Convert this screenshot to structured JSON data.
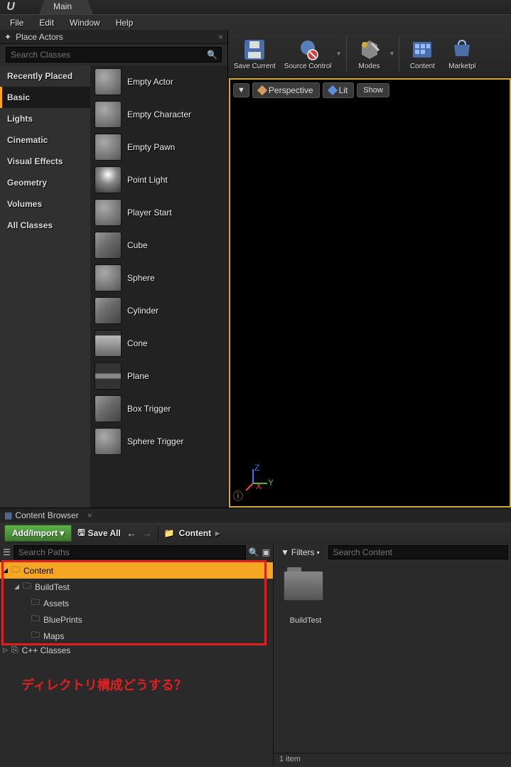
{
  "titlebar": {
    "tab": "Main"
  },
  "menu": {
    "file": "File",
    "edit": "Edit",
    "window": "Window",
    "help": "Help"
  },
  "place_actors": {
    "title": "Place Actors",
    "search_placeholder": "Search Classes",
    "categories": [
      "Recently Placed",
      "Basic",
      "Lights",
      "Cinematic",
      "Visual Effects",
      "Geometry",
      "Volumes",
      "All Classes"
    ],
    "active_category": "Basic",
    "actors": [
      "Empty Actor",
      "Empty Character",
      "Empty Pawn",
      "Point Light",
      "Player Start",
      "Cube",
      "Sphere",
      "Cylinder",
      "Cone",
      "Plane",
      "Box Trigger",
      "Sphere Trigger"
    ]
  },
  "toolbar": {
    "save": "Save Current",
    "source": "Source Control",
    "modes": "Modes",
    "content": "Content",
    "market": "Marketpl"
  },
  "viewport": {
    "perspective": "Perspective",
    "lit": "Lit",
    "show": "Show"
  },
  "content_browser": {
    "title": "Content Browser",
    "add_import": "Add/Import ▾",
    "save_all": "Save All",
    "breadcrumb": "Content",
    "search_paths_placeholder": "Search Paths",
    "filters": "Filters",
    "search_content_placeholder": "Search Content",
    "tree": {
      "content": "Content",
      "buildtest": "BuildTest",
      "assets": "Assets",
      "blueprints": "BluePrints",
      "maps": "Maps",
      "cpp": "C++ Classes"
    },
    "asset": {
      "name": "BuildTest"
    },
    "status": "1 item"
  },
  "annotation": "ディレクトリ構成どうする？"
}
